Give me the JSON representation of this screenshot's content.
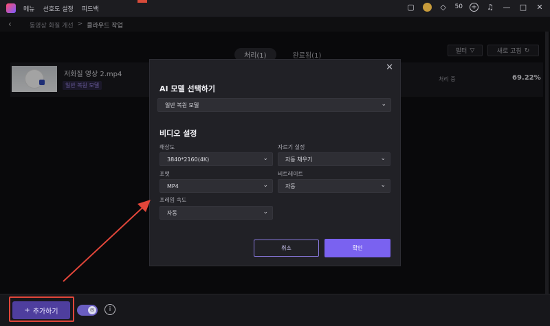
{
  "titlebar": {
    "menu": [
      "메뉴",
      "선호도 설정",
      "피드백"
    ],
    "credits": "50"
  },
  "breadcrumb": {
    "parent": "동영상 화질 개선",
    "separator": ">",
    "current": "클라우드 작업"
  },
  "tabs": [
    {
      "label": "처리(1)",
      "active": true
    },
    {
      "label": "완료됨(1)",
      "active": false
    }
  ],
  "toolbar": {
    "filter_label": "필터",
    "refresh_label": "새로 고침"
  },
  "task": {
    "file_name": "저화질 영상 2.mp4",
    "model_badge": "일반 복원 모델",
    "status": "처리 중",
    "progress": "69.22%"
  },
  "bottom": {
    "add_label": "추가하기",
    "add_icon": "+"
  },
  "modal": {
    "ai_section_title": "AI 모델 선택하기",
    "ai_model_value": "일반 복원 모델",
    "video_section_title": "비디오 설정",
    "resolution_label": "해상도",
    "resolution_value": "3840*2160(4K)",
    "crop_label": "자르기 설정",
    "crop_value": "자동 채우기",
    "format_label": "포맷",
    "format_value": "MP4",
    "bitrate_label": "비트레이트",
    "bitrate_value": "자동",
    "framerate_label": "프레임 속도",
    "framerate_value": "자동",
    "cancel_label": "취소",
    "confirm_label": "확인"
  },
  "colors": {
    "accent": "#7a62f0",
    "add_button": "#4e3e9e",
    "annotation_red": "#e2463a"
  }
}
